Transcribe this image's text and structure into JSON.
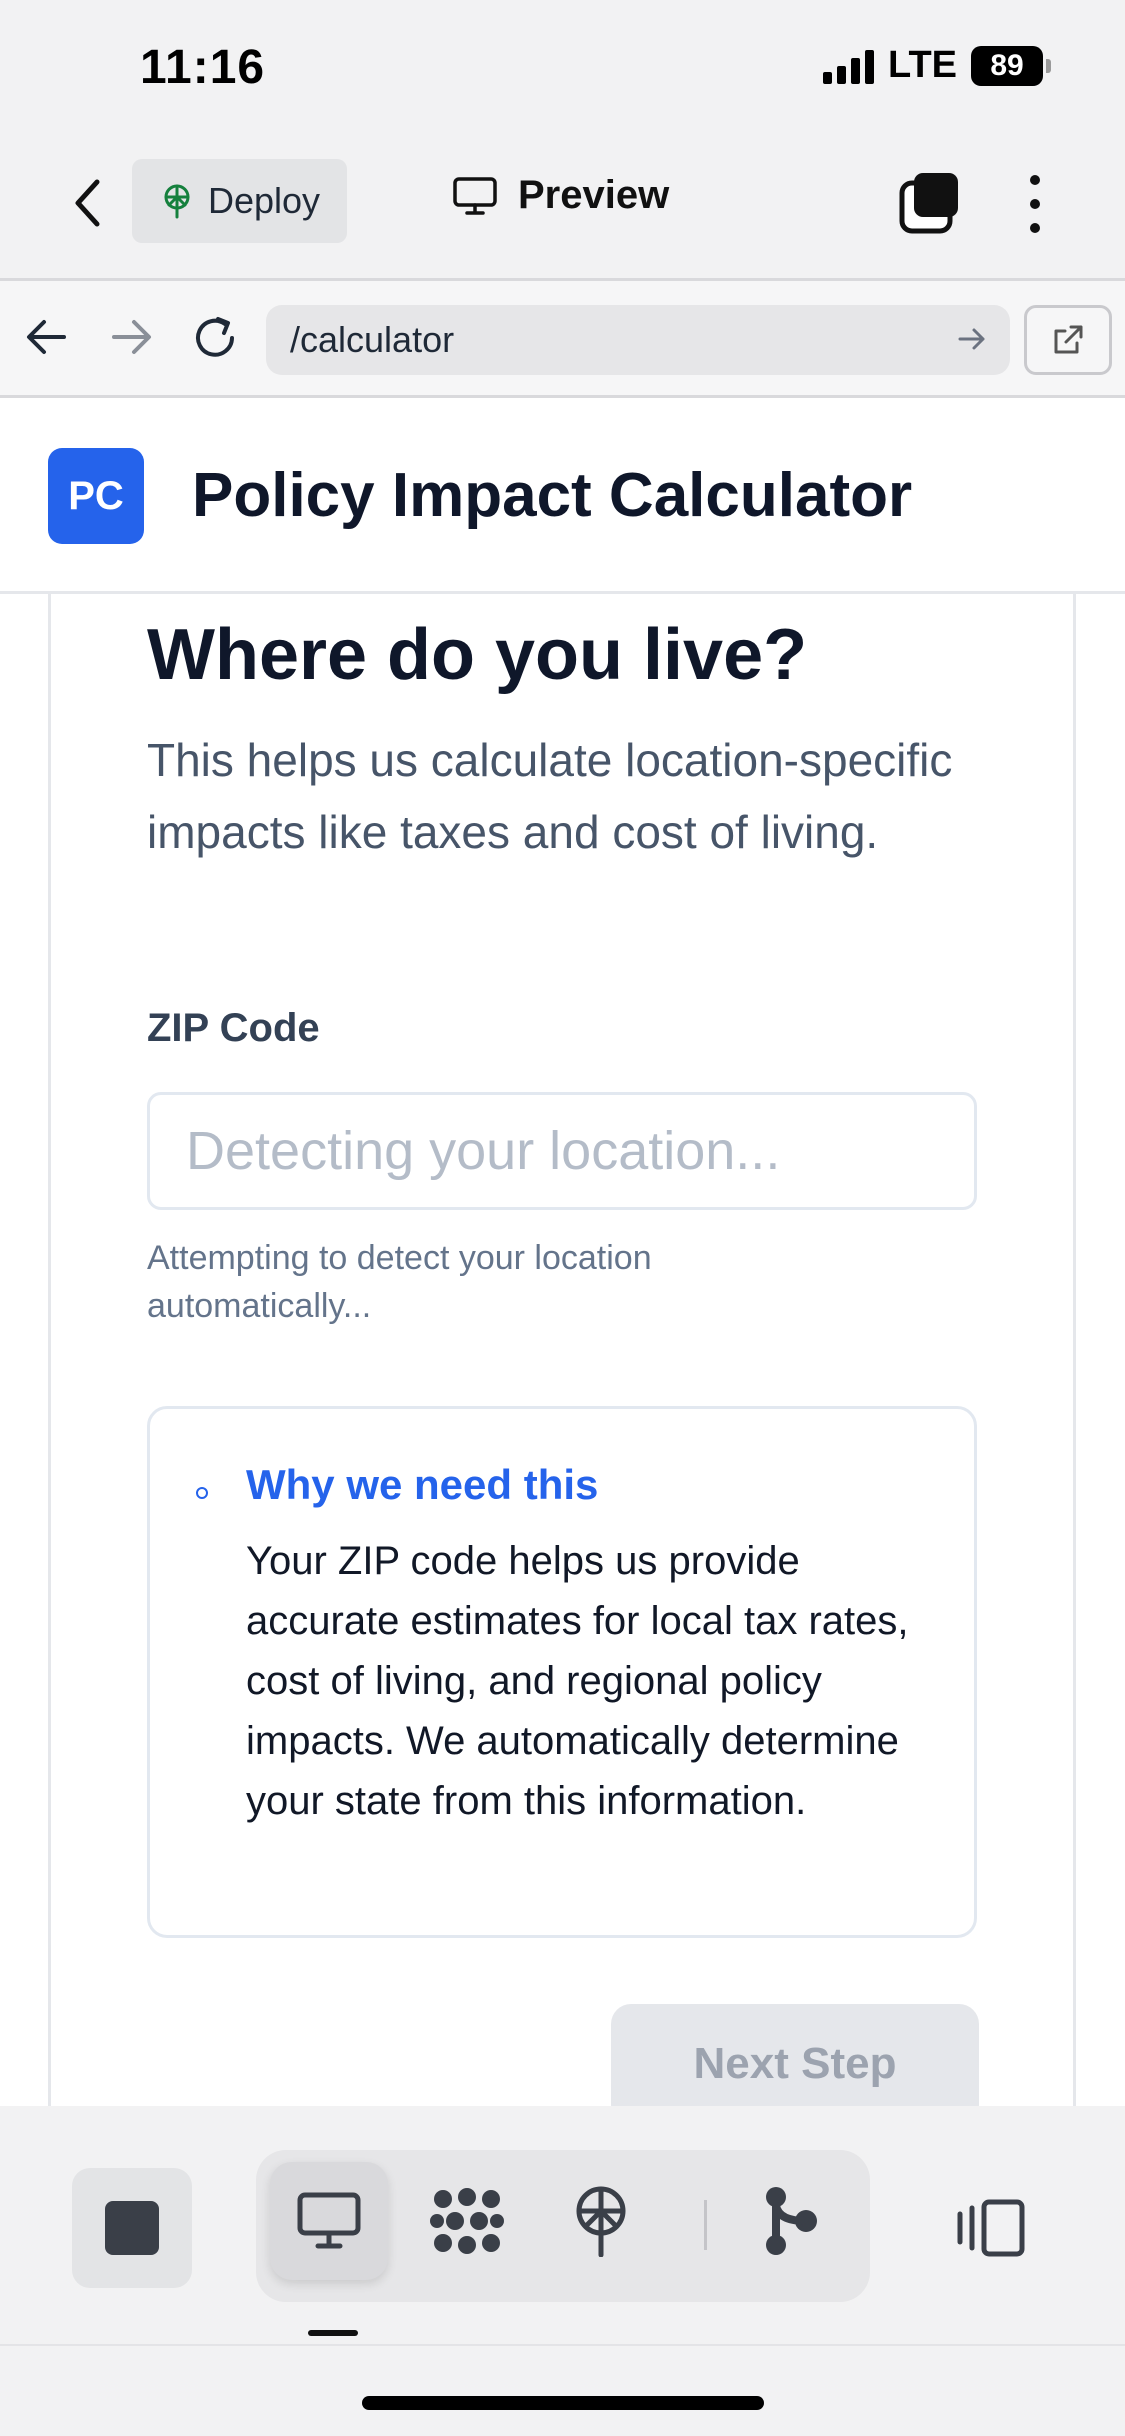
{
  "status_bar": {
    "time": "11:16",
    "network": "LTE",
    "battery": "89"
  },
  "app_toolbar": {
    "deploy_label": "Deploy",
    "preview_label": "Preview"
  },
  "browser": {
    "url": "/calculator"
  },
  "site": {
    "logo_text": "PC",
    "title": "Policy Impact Calculator",
    "brand_color": "#2563eb"
  },
  "step": {
    "heading": "Where do you live?",
    "description": "This helps us calculate location-specific impacts like taxes and cost of living.",
    "zip_label": "ZIP Code",
    "zip_value": "",
    "zip_placeholder": "Detecting your location...",
    "zip_help": "Attempting to detect your location automatically...",
    "info_title": "Why we need this",
    "info_text": "Your ZIP code helps us provide accurate estimates for local tax rates, cost of living, and regional policy impacts. We automatically determine your state from this information.",
    "next_label": "Next Step"
  },
  "bottom_bar": {
    "icons": [
      "stop-icon",
      "desktop-icon",
      "integrations-icon",
      "deploy-icon",
      "git-branch-icon",
      "panel-icon"
    ]
  }
}
